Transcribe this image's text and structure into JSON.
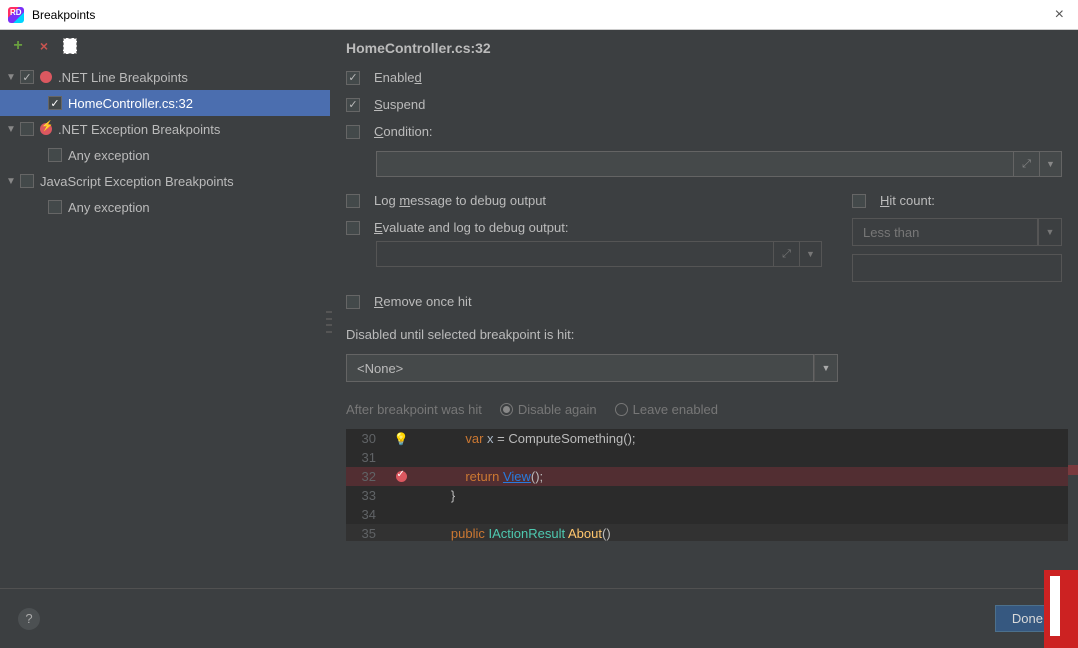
{
  "window": {
    "title": "Breakpoints",
    "close": "×"
  },
  "toolbar": {
    "add": "+",
    "remove": "×"
  },
  "tree": {
    "items": [
      {
        "label": ".NET Line Breakpoints",
        "type": "group",
        "checked": true,
        "icon": "dot",
        "indent": 0,
        "expanded": true
      },
      {
        "label": "HomeController.cs:32",
        "type": "leaf",
        "checked": true,
        "icon": "",
        "indent": 1,
        "selected": true
      },
      {
        "label": ".NET Exception Breakpoints",
        "type": "group",
        "checked": false,
        "icon": "exc",
        "indent": 0,
        "expanded": true
      },
      {
        "label": "Any exception",
        "type": "leaf",
        "checked": false,
        "icon": "",
        "indent": 1
      },
      {
        "label": "JavaScript Exception Breakpoints",
        "type": "group",
        "checked": false,
        "icon": "",
        "indent": 0,
        "expanded": true
      },
      {
        "label": "Any exception",
        "type": "leaf",
        "checked": false,
        "icon": "",
        "indent": 1
      }
    ]
  },
  "detail": {
    "title": "HomeController.cs:32",
    "enabled_label": "Enabled",
    "suspend_label": "Suspend",
    "condition_label": "Condition:",
    "log_message_label": "Log message to debug output",
    "evaluate_label": "Evaluate and log to debug output:",
    "hit_count_label": "Hit count:",
    "hit_count_mode": "Less than",
    "remove_once_label": "Remove once hit",
    "disabled_until_label": "Disabled until selected breakpoint is hit:",
    "disabled_until_value": "<None>",
    "after_hit_label": "After breakpoint was hit",
    "disable_again_label": "Disable again",
    "leave_enabled_label": "Leave enabled"
  },
  "code": {
    "lines": [
      {
        "num": "30",
        "icon": "bulb",
        "html": "            <span class='kw'>var</span> <span class='var'>x</span> = ComputeSomething();"
      },
      {
        "num": "31",
        "icon": "",
        "html": ""
      },
      {
        "num": "32",
        "icon": "bp",
        "hl": true,
        "html": "            <span class='kw'>return</span> <span class='link'>View</span>();"
      },
      {
        "num": "33",
        "icon": "",
        "html": "        }"
      },
      {
        "num": "34",
        "icon": "",
        "html": ""
      },
      {
        "num": "35",
        "icon": "",
        "caret": true,
        "html": "        <span class='kw'>public</span> <span class='type'>IActionResult</span> <span class='method'>About</span>()"
      }
    ]
  },
  "bottom": {
    "help": "?",
    "done": "Done"
  }
}
